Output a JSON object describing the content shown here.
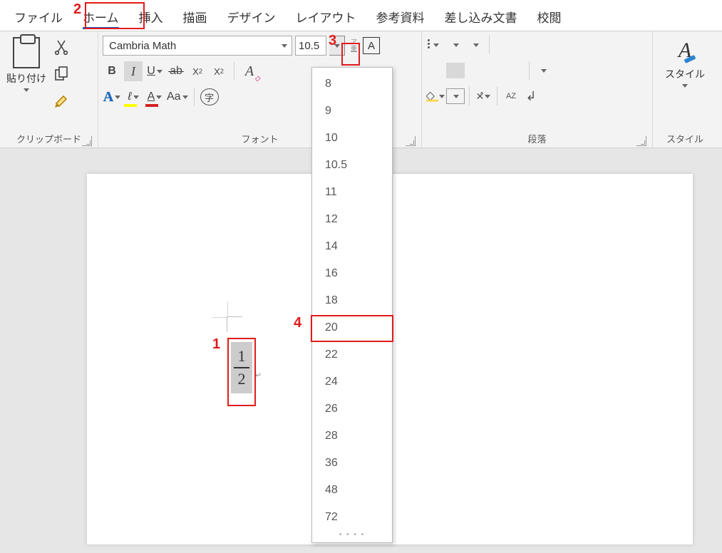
{
  "menu": {
    "items": [
      "ファイル",
      "ホーム",
      "挿入",
      "描画",
      "デザイン",
      "レイアウト",
      "参考資料",
      "差し込み文書",
      "校閲"
    ],
    "active_index": 1
  },
  "ribbon": {
    "clipboard": {
      "paste": "貼り付け",
      "group_label": "クリップボード"
    },
    "font": {
      "name": "Cambria Math",
      "size": "10.5",
      "group_label": "フォント",
      "phonetic_top": "ア",
      "phonetic_bottom": "亜",
      "char_border": "A",
      "bold": "B",
      "italic": "I",
      "underline": "U",
      "strike": "ab",
      "subscript_base": "X",
      "subscript_sub": "2",
      "superscript_base": "X",
      "superscript_sup": "2",
      "text_effects": "A",
      "highlight": "ℓ",
      "font_color": "A",
      "case": "Aa",
      "enclosed": "字"
    },
    "paragraph": {
      "group_label": "段落",
      "sort_a": "A",
      "sort_z": "Z"
    },
    "styles": {
      "label": "スタイル",
      "group_label": "スタイル"
    }
  },
  "size_dropdown": {
    "options": [
      "8",
      "9",
      "10",
      "10.5",
      "11",
      "12",
      "14",
      "16",
      "18",
      "20",
      "22",
      "24",
      "26",
      "28",
      "36",
      "48",
      "72"
    ]
  },
  "document": {
    "fraction": {
      "numerator": "1",
      "denominator": "2"
    }
  },
  "annotations": {
    "n1": "1",
    "n2": "2",
    "n3": "3",
    "n4": "4"
  }
}
